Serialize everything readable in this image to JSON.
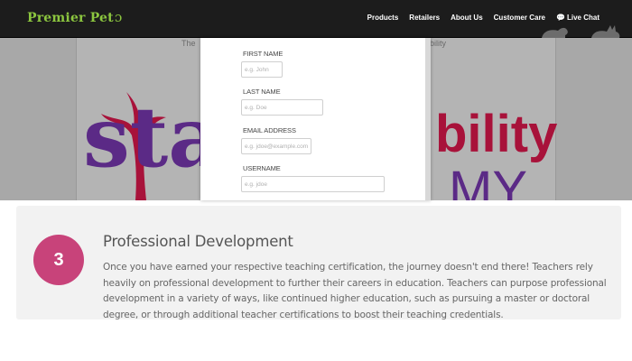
{
  "header": {
    "brand": "Premier Pet",
    "nav": [
      "Products",
      "Retailers",
      "About Us",
      "Customer Care",
      "Live Chat"
    ]
  },
  "background": {
    "tagline_left": "The",
    "tagline_right": "bility",
    "logo_left_text": "sta",
    "logo_right_text": "bility",
    "logo_right_sub": "MY"
  },
  "form": {
    "fields": [
      {
        "label": "FIRST NAME",
        "placeholder": "e.g. John"
      },
      {
        "label": "LAST NAME",
        "placeholder": "e.g. Doe"
      },
      {
        "label": "EMAIL ADDRESS",
        "placeholder": "e.g. jdoe@example.com"
      },
      {
        "label": "USERNAME",
        "placeholder": "e.g. jdoe"
      }
    ]
  },
  "step": {
    "number": "3",
    "title": "Professional Development",
    "body": "Once you have earned your respective teaching certification, the journey doesn't end there! Teachers rely heavily on professional development to further their careers in education. Teachers can purpose professional development in a variety of ways, like continued higher education, such as pursuing a master or doctoral degree, or through additional teacher certifications to boost their teaching credentials."
  },
  "colors": {
    "brand_green": "#8cc63f",
    "nav_bg": "#1c1c1c",
    "step_circle": "#c8437a",
    "logo_purple": "#5b2a86",
    "logo_red": "#a8123a"
  }
}
